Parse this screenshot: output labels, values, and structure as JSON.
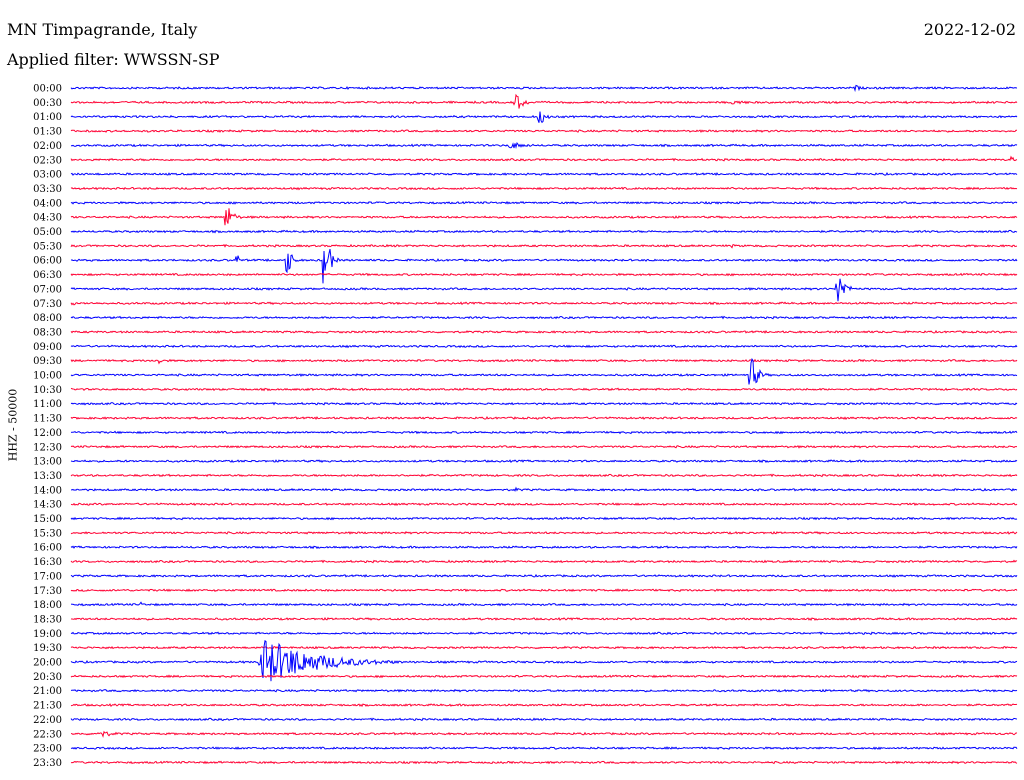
{
  "header": {
    "station": "MN Timpagrande, Italy",
    "date": "2022-12-02",
    "filter": "Applied filter: WWSSN-SP"
  },
  "chart_data": {
    "type": "line",
    "title": "MN Timpagrande, Italy",
    "date": "2022-12-02",
    "filter": "Applied filter: WWSSN-SP",
    "ylabel": "HHZ - 50000",
    "trace_colors": [
      "#0000ff",
      "#ff0033"
    ],
    "rows": [
      {
        "label": "00:00",
        "events": [
          {
            "x": 0.83,
            "amp": 3,
            "dur": 0.012
          },
          {
            "x": 0.12,
            "amp": 1,
            "dur": 0.03
          }
        ]
      },
      {
        "label": "00:30",
        "events": [
          {
            "x": 0.47,
            "amp": 8,
            "dur": 0.025
          },
          {
            "x": 0.7,
            "amp": 2,
            "dur": 0.06
          }
        ]
      },
      {
        "label": "01:00",
        "events": [
          {
            "x": 0.495,
            "amp": 7,
            "dur": 0.02
          }
        ]
      },
      {
        "label": "01:30",
        "events": []
      },
      {
        "label": "02:00",
        "events": [
          {
            "x": 0.465,
            "amp": 3,
            "dur": 0.05
          }
        ]
      },
      {
        "label": "02:30",
        "events": [
          {
            "x": 0.995,
            "amp": 3,
            "dur": 0.01
          }
        ]
      },
      {
        "label": "03:00",
        "events": [
          {
            "x": 0.82,
            "amp": 1,
            "dur": 0.05
          }
        ]
      },
      {
        "label": "03:30",
        "events": []
      },
      {
        "label": "04:00",
        "events": []
      },
      {
        "label": "04:30",
        "events": [
          {
            "x": 0.164,
            "amp": 12,
            "dur": 0.02
          }
        ]
      },
      {
        "label": "05:00",
        "events": []
      },
      {
        "label": "05:30",
        "events": [
          {
            "x": 0.7,
            "amp": 2,
            "dur": 0.005
          }
        ]
      },
      {
        "label": "06:00",
        "events": [
          {
            "x": 0.176,
            "amp": 5,
            "dur": 0.008
          },
          {
            "x": 0.229,
            "amp": 16,
            "dur": 0.012
          },
          {
            "x": 0.268,
            "amp": 30,
            "dur": 0.015
          }
        ]
      },
      {
        "label": "06:30",
        "events": [
          {
            "x": 0.547,
            "amp": 1,
            "dur": 0.004
          }
        ]
      },
      {
        "label": "07:00",
        "events": [
          {
            "x": 0.81,
            "amp": 18,
            "dur": 0.02
          }
        ]
      },
      {
        "label": "07:30",
        "events": [
          {
            "x": 0.003,
            "amp": 2,
            "dur": 0.006
          }
        ]
      },
      {
        "label": "08:00",
        "events": []
      },
      {
        "label": "08:30",
        "events": []
      },
      {
        "label": "09:00",
        "events": []
      },
      {
        "label": "09:30",
        "events": [
          {
            "x": 0.094,
            "amp": 5,
            "dur": 0.006
          }
        ]
      },
      {
        "label": "10:00",
        "events": [
          {
            "x": 0.718,
            "amp": 18,
            "dur": 0.02
          }
        ]
      },
      {
        "label": "10:30",
        "events": []
      },
      {
        "label": "11:00",
        "events": []
      },
      {
        "label": "11:30",
        "events": []
      },
      {
        "label": "12:00",
        "events": [
          {
            "x": 0.37,
            "amp": 1,
            "dur": 0.04
          }
        ]
      },
      {
        "label": "12:30",
        "events": []
      },
      {
        "label": "13:00",
        "events": [
          {
            "x": 0.06,
            "amp": 1,
            "dur": 0.01
          },
          {
            "x": 0.18,
            "amp": 1,
            "dur": 0.015
          }
        ]
      },
      {
        "label": "13:30",
        "events": []
      },
      {
        "label": "14:00",
        "events": [
          {
            "x": 0.47,
            "amp": 2,
            "dur": 0.015
          }
        ]
      },
      {
        "label": "14:30",
        "events": []
      },
      {
        "label": "15:00",
        "events": [
          {
            "x": 0.375,
            "amp": 1,
            "dur": 0.006
          }
        ]
      },
      {
        "label": "15:30",
        "events": []
      },
      {
        "label": "16:00",
        "events": []
      },
      {
        "label": "16:30",
        "events": []
      },
      {
        "label": "17:00",
        "events": []
      },
      {
        "label": "17:30",
        "events": []
      },
      {
        "label": "18:00",
        "events": [
          {
            "x": 0.075,
            "amp": 3,
            "dur": 0.005
          }
        ]
      },
      {
        "label": "18:30",
        "events": []
      },
      {
        "label": "19:00",
        "events": []
      },
      {
        "label": "19:30",
        "events": []
      },
      {
        "label": "20:00",
        "events": [
          {
            "x": 0.2,
            "amp": 22,
            "dur": 0.15
          }
        ]
      },
      {
        "label": "20:30",
        "events": []
      },
      {
        "label": "21:00",
        "events": []
      },
      {
        "label": "21:30",
        "events": []
      },
      {
        "label": "22:00",
        "events": []
      },
      {
        "label": "22:30",
        "events": [
          {
            "x": 0.03,
            "amp": 3,
            "dur": 0.05
          }
        ]
      },
      {
        "label": "23:00",
        "events": [
          {
            "x": 0.37,
            "amp": 1,
            "dur": 0.03
          }
        ]
      },
      {
        "label": "23:30",
        "events": []
      }
    ]
  }
}
